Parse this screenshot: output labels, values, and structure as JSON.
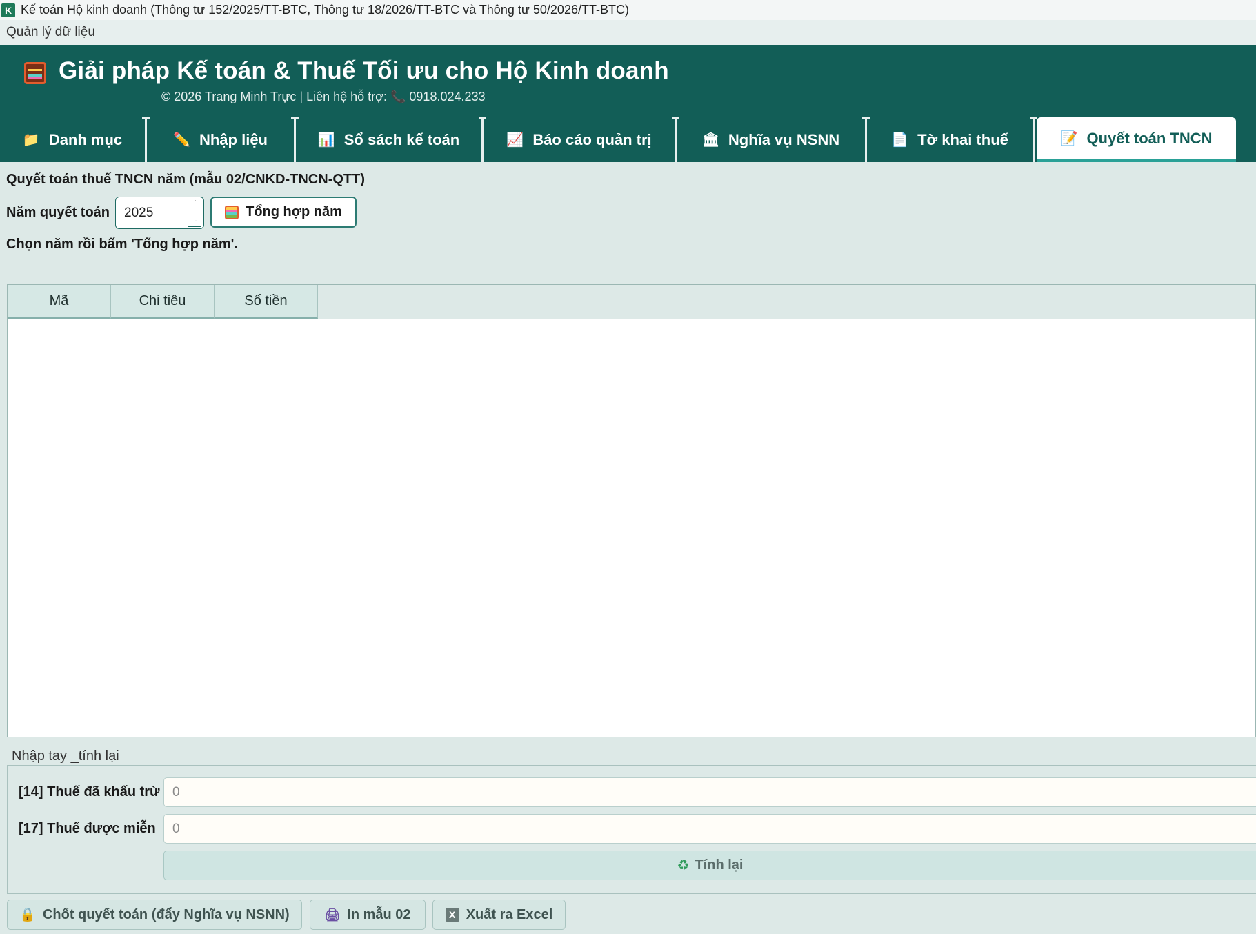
{
  "window": {
    "app_icon_letter": "K",
    "title": "Kế toán Hộ kinh doanh (Thông tư 152/2025/TT-BTC, Thông tư 18/2026/TT-BTC và Thông tư 50/2026/TT-BTC)"
  },
  "menu": {
    "items": [
      "Quản lý dữ liệu"
    ]
  },
  "header": {
    "title": "Giải pháp Kế toán & Thuế Tối ưu cho Hộ Kinh doanh",
    "subtitle_prefix": "© 2026 Trang Minh Trực | Liên hệ hỗ trợ:",
    "phone_glyph": "📞",
    "phone": "0918.024.233"
  },
  "tabs": [
    {
      "label": "Danh mục",
      "icon": "folder-icon",
      "glyph": "📁",
      "active": false
    },
    {
      "label": "Nhập liệu",
      "icon": "pencil-icon",
      "glyph": "✏️",
      "active": false
    },
    {
      "label": "Sổ sách kế toán",
      "icon": "bar-chart-icon",
      "glyph": "📊",
      "active": false
    },
    {
      "label": "Báo cáo quản trị",
      "icon": "line-chart-icon",
      "glyph": "📈",
      "active": false
    },
    {
      "label": "Nghĩa vụ NSNN",
      "icon": "bank-icon",
      "glyph": "🏛",
      "active": false
    },
    {
      "label": "Tờ khai thuế",
      "icon": "receipt-icon",
      "glyph": "📄",
      "active": false
    },
    {
      "label": "Quyết toán TNCN",
      "icon": "document-icon",
      "glyph": "📝",
      "active": true
    }
  ],
  "page": {
    "heading": "Quyết toán thuế TNCN năm (mẫu 02/CNKD-TNCN-QTT)",
    "year_label": "Năm quyết toán",
    "year_value": "2025",
    "summary_button": "Tổng hợp năm",
    "hint": "Chọn năm rồi bấm 'Tổng hợp năm'."
  },
  "table": {
    "columns": [
      "Mã",
      "Chi tiêu",
      "Số tiền"
    ],
    "rows": []
  },
  "manual": {
    "group_label": "Nhập tay _tính lại",
    "field14_label": "[14] Thuế đã khấu trừ",
    "field14_value": "0",
    "field17_label": "[17] Thuế được miễn",
    "field17_value": "0",
    "recalc_button": "Tính lại"
  },
  "footer": {
    "finalize_button": "Chốt quyết toán (đẩy Nghĩa vụ NSNN)",
    "print_button": "In mẫu 02",
    "excel_button": "Xuất ra Excel",
    "excel_glyph": "X"
  }
}
